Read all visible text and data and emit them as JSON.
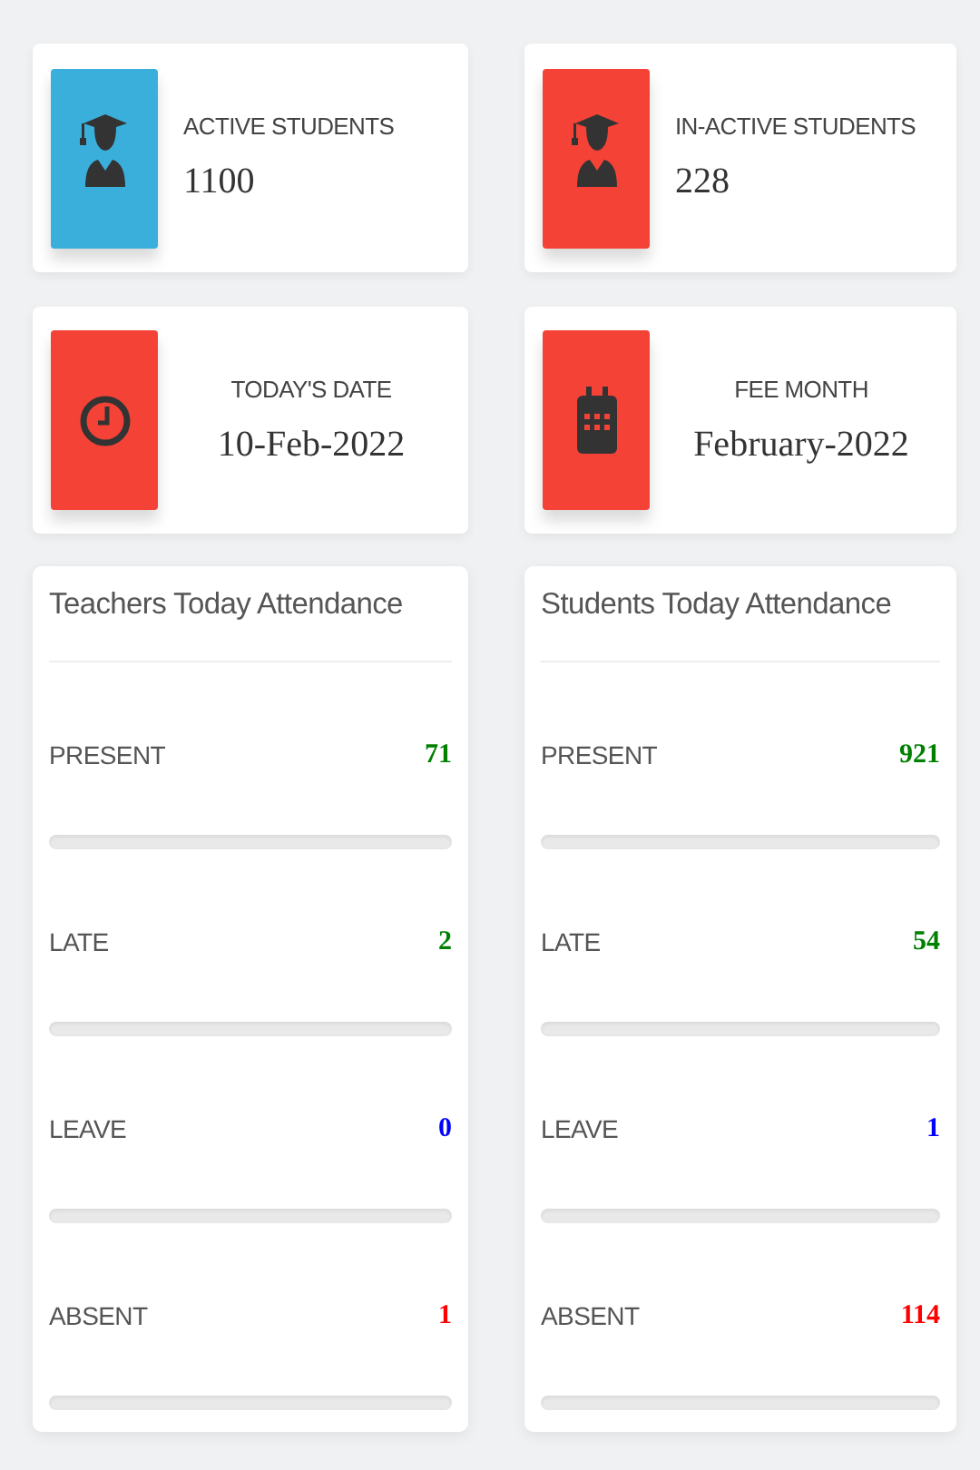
{
  "stat_cards": [
    {
      "kind": "students",
      "color": "#3aafdc",
      "label": "ACTIVE STUDENTS",
      "value": "1100"
    },
    {
      "kind": "students",
      "color": "#f44336",
      "label": "IN-ACTIVE STUDENTS",
      "value": "228"
    },
    {
      "kind": "date",
      "color": "#f44336",
      "label": "TODAY'S DATE",
      "value": "10-Feb-2022"
    },
    {
      "kind": "month",
      "color": "#f44336",
      "label": "FEE MONTH",
      "value": "February-2022"
    }
  ],
  "attendance_panels": [
    {
      "title": "Teachers Today Attendance",
      "rows": [
        {
          "label": "PRESENT",
          "count": "71",
          "color": "#008000",
          "level": 0
        },
        {
          "label": "LATE",
          "count": "2",
          "color": "#008000",
          "level": 0
        },
        {
          "label": "LEAVE",
          "count": "0",
          "color": "#0000ff",
          "level": 0
        },
        {
          "label": "ABSENT",
          "count": "1",
          "color": "#ff0000",
          "level": 0
        }
      ]
    },
    {
      "title": "Students Today Attendance",
      "rows": [
        {
          "label": "PRESENT",
          "count": "921",
          "color": "#008000",
          "level": 0
        },
        {
          "label": "LATE",
          "count": "54",
          "color": "#008000",
          "level": 0
        },
        {
          "label": "LEAVE",
          "count": "1",
          "color": "#0000ff",
          "level": 0
        },
        {
          "label": "ABSENT",
          "count": "114",
          "color": "#ff0000",
          "level": 0
        }
      ]
    }
  ]
}
